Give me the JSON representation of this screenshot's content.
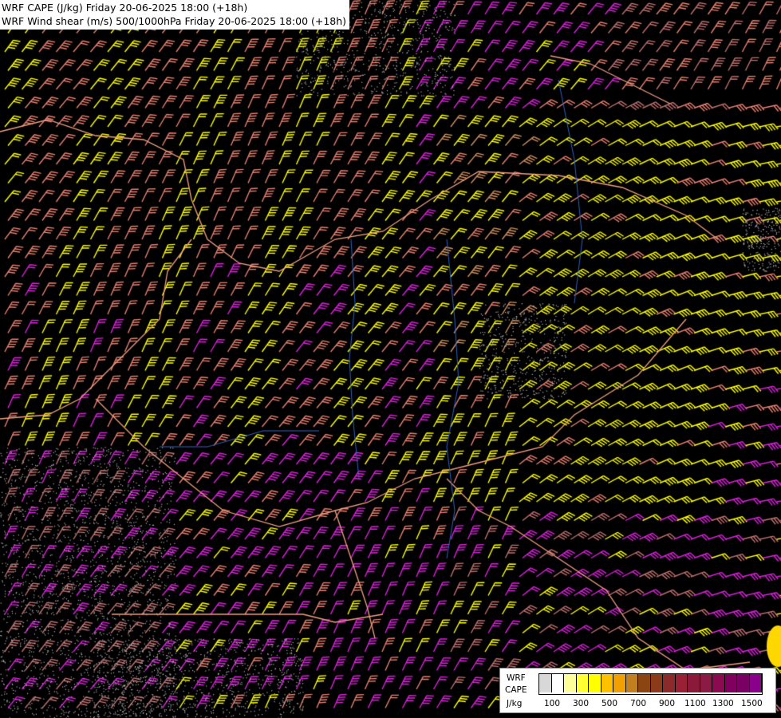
{
  "titles": {
    "line1": "WRF CAPE (J/kg) Friday 20-06-2025 18:00 (+18h)",
    "line2": "WRF Wind shear (m/s) 500/1000hPa Friday 20-06-2025 18:00 (+18h)"
  },
  "legend": {
    "label_model": "WRF",
    "label_param": "CAPE",
    "label_unit": "J/kg",
    "ticks": [
      "100",
      "300",
      "500",
      "700",
      "900",
      "1100",
      "1300",
      "1500"
    ],
    "colors": [
      "#d8d8d8",
      "#ffffff",
      "#ffff99",
      "#ffff33",
      "#ffff00",
      "#ffc000",
      "#f0a000",
      "#c08020",
      "#8b4513",
      "#8b3a1a",
      "#8b2a2a",
      "#9a2035",
      "#8b1a3a",
      "#8b1a45",
      "#8b0a50",
      "#800060",
      "#7a0066",
      "#8b008b"
    ]
  },
  "barb_colors": {
    "yellow": "#ffff00",
    "salmon": "#e88070",
    "magenta": "#e020e0",
    "rosybrown": "#c07070",
    "tan": "#d09060",
    "border": "#f0a080",
    "river": "#3060c0",
    "coast": "#b0b0b0"
  }
}
